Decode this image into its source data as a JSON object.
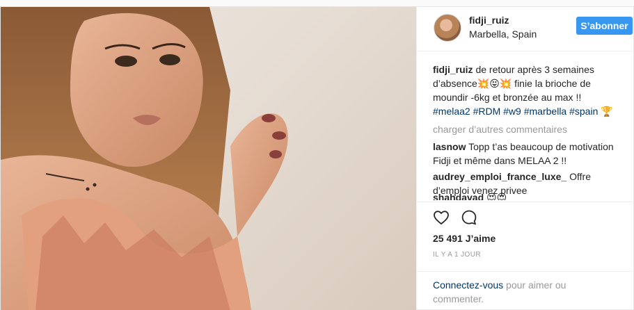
{
  "post": {
    "username": "fidji_ruiz",
    "location": "Marbella, Spain",
    "follow_label": "S’abonner",
    "caption": {
      "text_a": "de retour après 3 semaines d’absence",
      "emoji_a": "💥😝💥",
      "text_b": " finie la brioche de moundir -6kg et bronzée au max !! ",
      "tags": [
        "#melaa2",
        "#RDM",
        "#w9",
        "#marbella",
        "#spain"
      ],
      "emoji_b": "🏆"
    },
    "load_more_label": "charger d’autres commentaires",
    "comments": [
      {
        "user": "lasnow",
        "text": "Topp t’as beaucoup de motivation Fidji et même dans MELAA 2 !!"
      },
      {
        "user": "audrey_emploi_france_luxe_",
        "text": "Offre d’emploi venez privee"
      },
      {
        "user": "shahdavad",
        "text": "😍😍"
      }
    ],
    "likes": "25 491 J’aime",
    "time": "IL Y A 1 JOUR",
    "login": {
      "link": "Connectez-vous",
      "text": " pour aimer ou commenter."
    }
  },
  "icons": {
    "like": "heart-icon",
    "comment": "comment-bubble-icon"
  },
  "colors": {
    "accent": "#3897f0",
    "hashtag": "#003569",
    "muted": "#999999"
  }
}
